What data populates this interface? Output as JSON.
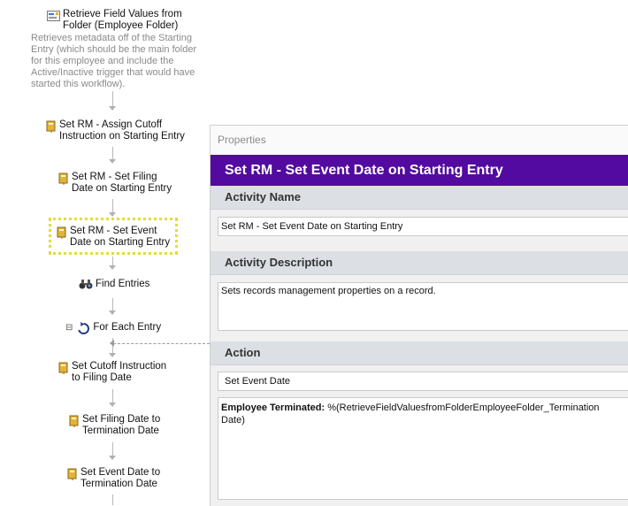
{
  "workflow": {
    "items": [
      {
        "label": "Retrieve Field Values from\nFolder (Employee Folder)",
        "icon": "retrieve-fields-icon"
      },
      {
        "label": "Set RM - Assign Cutoff\nInstruction on Starting Entry",
        "icon": "records-management-icon"
      },
      {
        "label": "Set RM - Set Filing\nDate on Starting Entry",
        "icon": "records-management-icon"
      },
      {
        "label": "Set RM - Set Event\nDate on Starting Entry",
        "icon": "records-management-icon",
        "selected": true
      },
      {
        "label": "Find Entries",
        "icon": "binoculars-icon"
      },
      {
        "label": "For Each Entry",
        "icon": "loop-icon"
      },
      {
        "label": "Set Cutoff Instruction\nto Filing Date",
        "icon": "records-management-icon"
      },
      {
        "label": "Set Filing Date to\nTermination Date",
        "icon": "records-management-icon"
      },
      {
        "label": "Set Event Date to\nTermination Date",
        "icon": "records-management-icon"
      }
    ],
    "retrieve_description": "Retrieves metadata off of the Starting\nEntry (which should be the main folder\nfor this employee and include the\nActive/Inactive trigger that would have\nstarted this workflow).",
    "collapse_symbol": "⊟"
  },
  "properties": {
    "title": "Properties",
    "header": "Set RM - Set Event Date on Starting Entry",
    "activity_name_heading": "Activity Name",
    "activity_name_value": "Set RM - Set Event Date on Starting Entry",
    "activity_description_heading": "Activity Description",
    "activity_description_value": "Sets records management properties on a record.",
    "action_heading": "Action",
    "action_value": "Set Event Date",
    "expression_label": "Employee Terminated:",
    "expression_value": "%(RetrieveFieldValuesfromFolderEmployeeFolder_Termination Date)"
  },
  "colors": {
    "header_bg": "#530aa0",
    "section_bg": "#dcdfe4",
    "selection_outline": "#e3dc3a"
  }
}
